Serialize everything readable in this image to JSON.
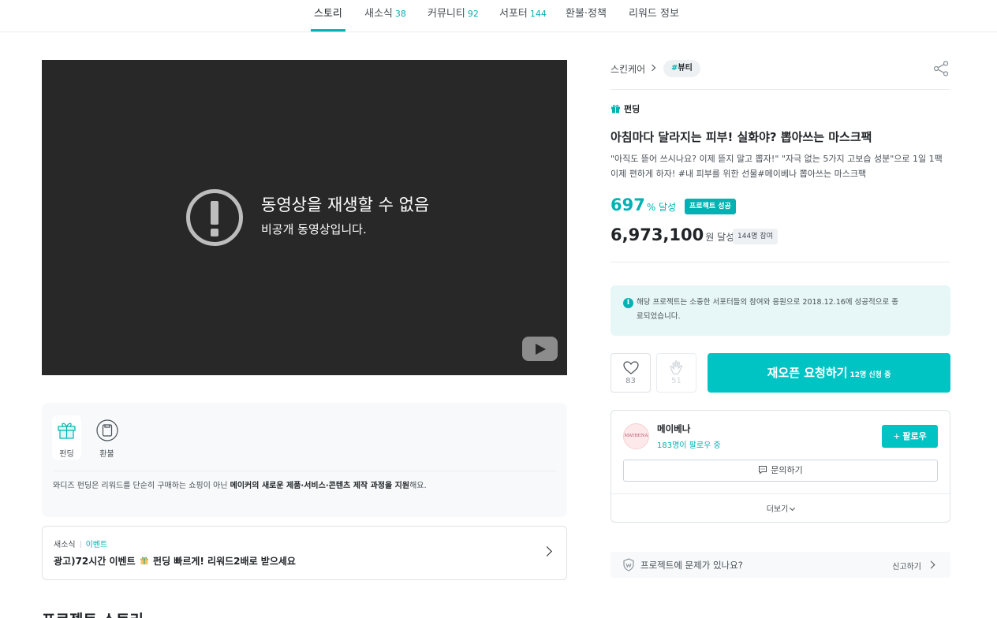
{
  "nav": {
    "tabs": [
      {
        "label": "스토리",
        "count": ""
      },
      {
        "label": "새소식",
        "count": "38"
      },
      {
        "label": "커뮤니티",
        "count": "92"
      },
      {
        "label": "서포터",
        "count": "144"
      },
      {
        "label": "환불·정책",
        "count": ""
      },
      {
        "label": "리워드 정보",
        "count": ""
      }
    ],
    "active_color": "#00b2b2"
  },
  "video": {
    "error_title": "동영상을 재생할 수 없음",
    "error_subtitle": "비공개 동영상입니다."
  },
  "funding_info": {
    "items": [
      {
        "label": "펀딩",
        "icon": "gift-icon"
      },
      {
        "label": "환불",
        "icon": "refund-icon"
      }
    ],
    "desc_prefix": "와디즈 펀딩은 리워드를 단순히 구매하는 쇼핑이 아닌 ",
    "desc_bold": "메이커의 새로운 제품·서비스·콘텐츠 제작 과정을 지원",
    "desc_suffix": "해요."
  },
  "news_card": {
    "category": "새소식",
    "type": "이벤트",
    "title_before": "광고)72시간 이벤트",
    "title_after": " 펀딩 빠르게! 리워드2배로 받으세요"
  },
  "story_heading": "프로젝트 스토리",
  "project": {
    "breadcrumb": "스킨케어",
    "tag_hash": "#",
    "tag": "뷰티",
    "funding_type": "펀딩",
    "title": "아침마다 달라지는 피부! 실화야? 뽑아쓰는 마스크팩",
    "description": "\"아직도 뜯어 쓰시나요? 이제 뜯지 말고 뽑자!\" \"자극 없는 5가지 고보습 성분\"으로 1일 1팩 이제 편하게 하자! #내 피부를 위한 선물#메이베나 뽑아쓰는 마스크팩",
    "percent": "697",
    "percent_unit": "% 달성",
    "success_badge": "프로젝트 성공",
    "amount": "6,973,100",
    "amount_unit": "원 달성",
    "participants": "144명 참여",
    "notice": "해당 프로젝트는 소중한 서포터들의 참여와 응원으로 2018.12.16에 성공적으로 종료되었습니다.",
    "likes": "83",
    "cheers": "51",
    "reopen_label": "재오픈 요청하기",
    "reopen_count": "12명 신청 중",
    "accent_color": "#00c4c4"
  },
  "maker": {
    "avatar_text": "MAYBENA",
    "name": "메이베나",
    "followers": "183명이 팔로우 중",
    "follow_label": "팔로우",
    "inquiry_label": "문의하기",
    "more_label": "더보기"
  },
  "report": {
    "question": "프로젝트에 문제가 있나요?",
    "action": "신고하기"
  }
}
